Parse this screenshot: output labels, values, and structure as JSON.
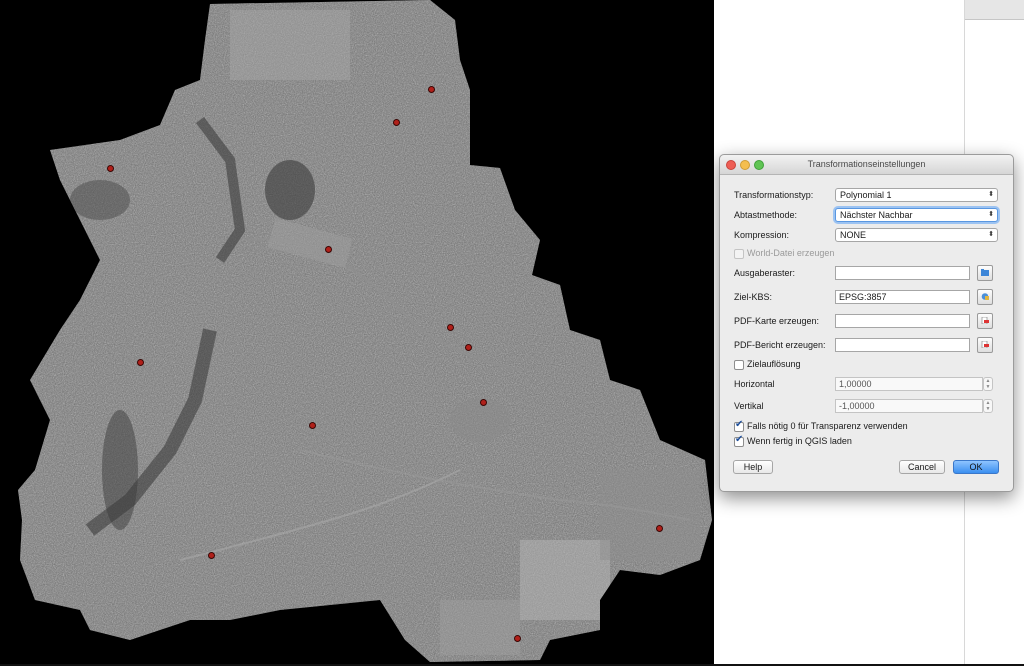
{
  "dialog": {
    "title": "Transformationseinstellungen",
    "fields": {
      "transformationstyp": {
        "label": "Transformationstyp:",
        "value": "Polynomial 1"
      },
      "abtastmethode": {
        "label": "Abtastmethode:",
        "value": "Nächster Nachbar"
      },
      "kompression": {
        "label": "Kompression:",
        "value": "NONE"
      },
      "world_datei": {
        "label": "World-Datei erzeugen",
        "checked": false,
        "enabled": false
      },
      "ausgaberaster": {
        "label": "Ausgaberaster:",
        "value": ""
      },
      "ziel_kbs": {
        "label": "Ziel-KBS:",
        "value": "EPSG:3857"
      },
      "pdf_karte": {
        "label": "PDF-Karte erzeugen:",
        "value": ""
      },
      "pdf_bericht": {
        "label": "PDF-Bericht erzeugen:",
        "value": ""
      },
      "zielaufloesung": {
        "label": "Zielauflösung",
        "checked": false
      },
      "horizontal": {
        "label": "Horizontal",
        "value": "1,00000"
      },
      "vertikal": {
        "label": "Vertikal",
        "value": "-1,00000"
      },
      "transparenz": {
        "label": "Falls nötig 0 für Transparenz verwenden",
        "checked": true
      },
      "qgis_laden": {
        "label": "Wenn fertig in QGIS laden",
        "checked": true
      }
    },
    "buttons": {
      "help": "Help",
      "cancel": "Cancel",
      "ok": "OK"
    }
  },
  "map": {
    "description": "",
    "marker_color": "#b0201a"
  },
  "icons": {
    "close": "close-icon",
    "minimize": "minimize-icon",
    "zoom": "zoom-icon",
    "output_raster_picker": "folder-icon",
    "crs_picker": "globe-icon",
    "pdf_picker": "pdf-icon"
  }
}
